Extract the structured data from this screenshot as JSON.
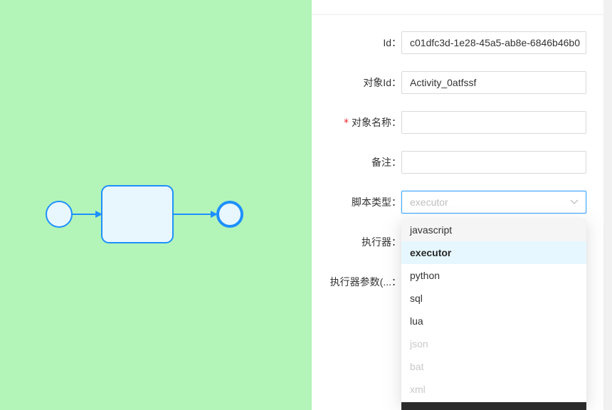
{
  "form": {
    "id": {
      "label": "Id：",
      "value": "c01dfc3d-1e28-45a5-ab8e-6846b46b0"
    },
    "object_id": {
      "label": "对象Id：",
      "value": "Activity_0atfssf"
    },
    "object_name": {
      "required_mark": "*",
      "label": "对象名称：",
      "value": ""
    },
    "remark": {
      "label": "备注：",
      "value": ""
    },
    "script_type": {
      "label": "脚本类型：",
      "value": "executor"
    },
    "executor": {
      "label": "执行器："
    },
    "executor_params": {
      "label": "执行器参数(...："
    }
  },
  "dropdown": {
    "options": [
      "javascript",
      "executor",
      "python",
      "sql",
      "lua",
      "json",
      "bat",
      "xml"
    ],
    "hovered": "javascript",
    "selected": "executor",
    "disabled": [
      "json",
      "bat",
      "xml"
    ]
  },
  "colors": {
    "canvas_bg": "#b3f4b8",
    "bpmn_stroke": "#1e90ff",
    "task_fill": "#e8f6fe",
    "accent": "#40a9ff",
    "required": "#f5222d"
  },
  "icons": {
    "select_arrow": "chevron-down-icon"
  }
}
